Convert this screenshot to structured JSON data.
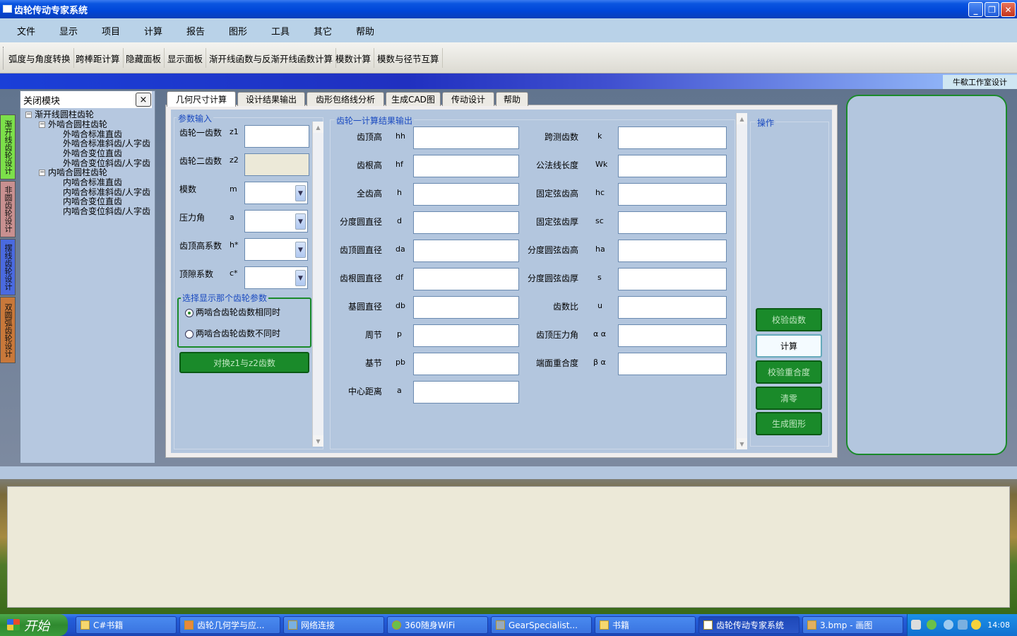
{
  "window": {
    "title": "齿轮传动专家系统",
    "min": "_",
    "max": "❐",
    "close": "✕"
  },
  "menu": [
    "文件",
    "显示",
    "项目",
    "计算",
    "报告",
    "图形",
    "工具",
    "其它",
    "帮助"
  ],
  "toolbar": [
    "弧度与角度转换",
    "跨棒距计算",
    "隐藏面板",
    "显示面板",
    "渐开线函数与反渐开线函数计算",
    "模数计算",
    "模数与径节互算"
  ],
  "credit": "牛欷工作室设计",
  "side_tabs": [
    {
      "label": "渐开线齿轮设计",
      "color": "#7ce04a"
    },
    {
      "label": "非圆齿轮设计",
      "color": "#c89090"
    },
    {
      "label": "摆线齿轮设计",
      "color": "#4a6ae0"
    },
    {
      "label": "双圆弧齿轮设计",
      "color": "#c8783a"
    }
  ],
  "module_panel": {
    "title": "关闭模块",
    "close": "×",
    "tree": {
      "root": "渐开线圆柱齿轮",
      "groups": [
        {
          "label": "外啮合圆柱齿轮",
          "items": [
            "外啮合标准直齿",
            "外啮合标准斜齿/人字齿",
            "外啮合变位直齿",
            "外啮合变位斜齿/人字齿"
          ]
        },
        {
          "label": "内啮合圆柱齿轮",
          "items": [
            "内啮合标准直齿",
            "内啮合标准斜齿/人字齿",
            "内啮合变位直齿",
            "内啮合变位斜齿/人字齿"
          ]
        }
      ]
    }
  },
  "tabs": [
    "几何尺寸计算",
    "设计结果输出",
    "齿形包络线分析",
    "生成CAD图",
    "传动设计",
    "帮助"
  ],
  "params": {
    "title": "参数输入",
    "rows": [
      {
        "label": "齿轮一齿数",
        "sym": "z1"
      },
      {
        "label": "齿轮二齿数",
        "sym": "z2"
      },
      {
        "label": "模数",
        "sym": "m"
      },
      {
        "label": "压力角",
        "sym": "a"
      },
      {
        "label": "齿顶高系数",
        "sym": "h*"
      },
      {
        "label": "顶隙系数",
        "sym": "c*"
      }
    ],
    "select_title": "选择显示那个齿轮参数",
    "radio1": "两啮合齿轮齿数相同时",
    "radio2": "两啮合齿轮齿数不同时",
    "swap_button": "对换z1与z2齿数"
  },
  "results": {
    "title": "齿轮一计算结果输出",
    "left": [
      {
        "label": "齿顶高",
        "sym": "hh"
      },
      {
        "label": "齿根高",
        "sym": "hf"
      },
      {
        "label": "全齿高",
        "sym": "h"
      },
      {
        "label": "分度圆直径",
        "sym": "d"
      },
      {
        "label": "齿顶圆直径",
        "sym": "da"
      },
      {
        "label": "齿根圆直径",
        "sym": "df"
      },
      {
        "label": "基圆直径",
        "sym": "db"
      },
      {
        "label": "周节",
        "sym": "p"
      },
      {
        "label": "基节",
        "sym": "pb"
      },
      {
        "label": "中心距离",
        "sym": "a"
      }
    ],
    "right": [
      {
        "label": "跨测齿数",
        "sym": "k"
      },
      {
        "label": "公法线长度",
        "sym": "Wk"
      },
      {
        "label": "固定弦齿高",
        "sym": "hc"
      },
      {
        "label": "固定弦齿厚",
        "sym": "sc"
      },
      {
        "label": "分度圆弦齿高",
        "sym": "ha"
      },
      {
        "label": "分度圆弦齿厚",
        "sym": "s"
      },
      {
        "label": "齿数比",
        "sym": "u"
      },
      {
        "label": "齿顶压力角",
        "sym": "α α"
      },
      {
        "label": "端面重合度",
        "sym": "β α"
      }
    ]
  },
  "ops": {
    "title": "操作",
    "buttons": [
      "校验齿数",
      "计算",
      "校验重合度",
      "清零",
      "生成图形"
    ]
  },
  "taskbar": {
    "start": "开始",
    "tasks": [
      "C#书籍",
      "齿轮几何学与应...",
      "网络连接",
      "360随身WiFi",
      "GearSpecialist...",
      "书籍",
      "齿轮传动专家系统",
      "3.bmp - 画图"
    ],
    "clock": "14:08"
  }
}
